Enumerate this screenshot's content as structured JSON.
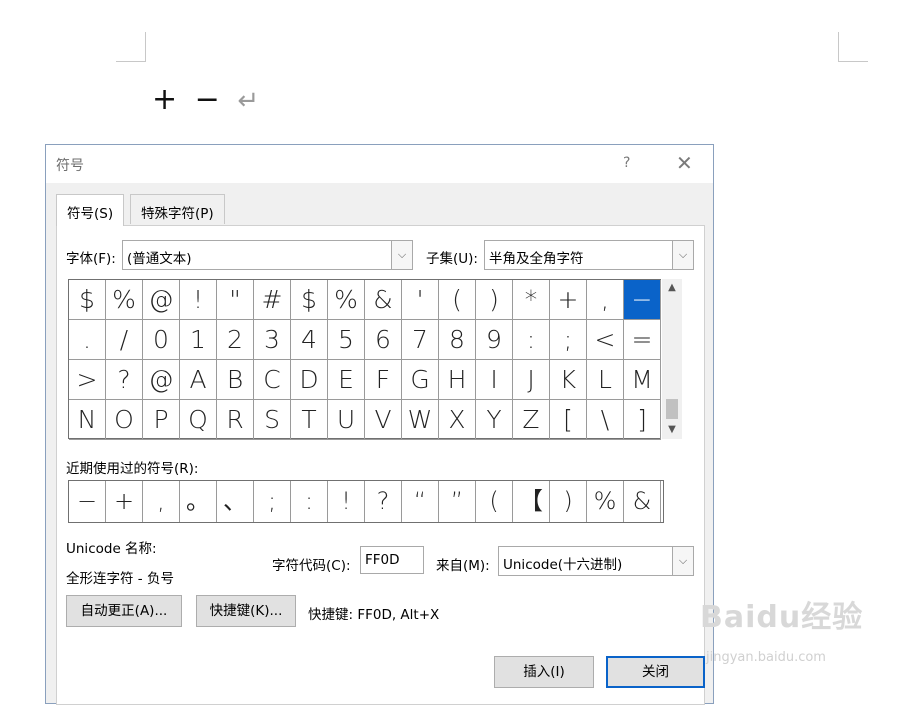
{
  "document": {
    "content_symbols": "+ −",
    "return_mark": "↵"
  },
  "dialog": {
    "title": "符号",
    "help": "?",
    "close": "✕",
    "tabs": [
      {
        "label": "符号(S)"
      },
      {
        "label": "特殊字符(P)"
      }
    ],
    "font_label": "字体(F):",
    "font_value": "(普通文本)",
    "subset_label": "子集(U):",
    "subset_value": "半角及全角字符",
    "symbols": [
      [
        "$",
        "%",
        "@",
        "!",
        "\"",
        "#",
        "$",
        "%",
        "&",
        "'",
        "(",
        ")",
        "*",
        "+",
        ",",
        "−"
      ],
      [
        ".",
        "/",
        "0",
        "1",
        "2",
        "3",
        "4",
        "5",
        "6",
        "7",
        "8",
        "9",
        ":",
        ";",
        "<",
        "="
      ],
      [
        ">",
        "?",
        "@",
        "A",
        "B",
        "C",
        "D",
        "E",
        "F",
        "G",
        "H",
        "I",
        "J",
        "K",
        "L",
        "M"
      ],
      [
        "N",
        "O",
        "P",
        "Q",
        "R",
        "S",
        "T",
        "U",
        "V",
        "W",
        "X",
        "Y",
        "Z",
        "[",
        "\\",
        "]"
      ]
    ],
    "selected_symbol_index": 15,
    "recent_label": "近期使用过的符号(R):",
    "recent_symbols": [
      "−",
      "+",
      ",",
      "。",
      "、",
      ";",
      ":",
      "!",
      "?",
      "“",
      "”",
      "(",
      "【",
      ")",
      "%",
      "&"
    ],
    "unicode_name_label": "Unicode 名称:",
    "unicode_name_value": "全形连字符 - 负号",
    "char_code_label": "字符代码(C):",
    "char_code_value": "FF0D",
    "from_label": "来自(M):",
    "from_value": "Unicode(十六进制)",
    "autocorrect_button": "自动更正(A)...",
    "shortcut_button": "快捷键(K)...",
    "shortcut_text": "快捷键: FF0D, Alt+X",
    "insert_button": "插入(I)",
    "close_button": "关闭"
  },
  "watermark": {
    "text": "Baidu经验",
    "url": "jingyan.baidu.com"
  },
  "colors": {
    "selection": "#0a63c9",
    "dialog_bg": "#f0f0f0"
  }
}
